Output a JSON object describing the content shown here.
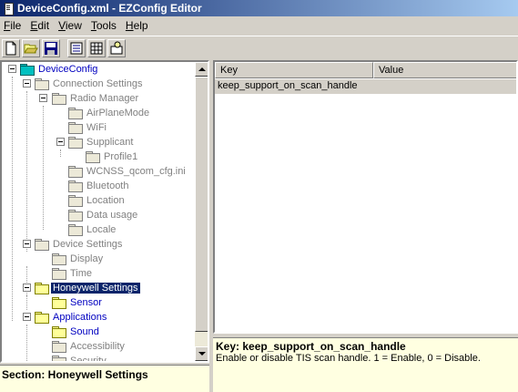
{
  "window": {
    "title": "DeviceConfig.xml - EZConfig Editor"
  },
  "menu": [
    {
      "label": "File",
      "accel": "F",
      "rest": "ile"
    },
    {
      "label": "Edit",
      "accel": "E",
      "rest": "dit"
    },
    {
      "label": "View",
      "accel": "V",
      "rest": "iew"
    },
    {
      "label": "Tools",
      "accel": "T",
      "rest": "ools"
    },
    {
      "label": "Help",
      "accel": "H",
      "rest": "elp"
    }
  ],
  "toolbar": {
    "icons": [
      "new-file-icon",
      "open-folder-icon",
      "save-icon",
      "properties-icon",
      "grid-icon",
      "import-icon"
    ]
  },
  "tree": {
    "root": "DeviceConfig",
    "connection_settings": "Connection Settings",
    "radio_manager": "Radio Manager",
    "airplane_mode": "AirPlaneMode",
    "wifi": "WiFi",
    "supplicant": "Supplicant",
    "profile1": "Profile1",
    "wcnss": "WCNSS_qcom_cfg.ini",
    "bluetooth": "Bluetooth",
    "location": "Location",
    "data_usage": "Data usage",
    "locale": "Locale",
    "device_settings": "Device Settings",
    "display": "Display",
    "time": "Time",
    "honeywell_settings": "Honeywell Settings",
    "sensor": "Sensor",
    "applications": "Applications",
    "sound": "Sound",
    "accessibility": "Accessibility",
    "security": "Security"
  },
  "section_status": "Section: Honeywell Settings",
  "list": {
    "columns": [
      "Key",
      "Value"
    ],
    "rows": [
      {
        "key": "keep_support_on_scan_handle",
        "value": ""
      }
    ]
  },
  "description": {
    "key_line": "Key: keep_support_on_scan_handle",
    "text": "Enable or disable TIS scan handle. 1 = Enable, 0 = Disable."
  }
}
